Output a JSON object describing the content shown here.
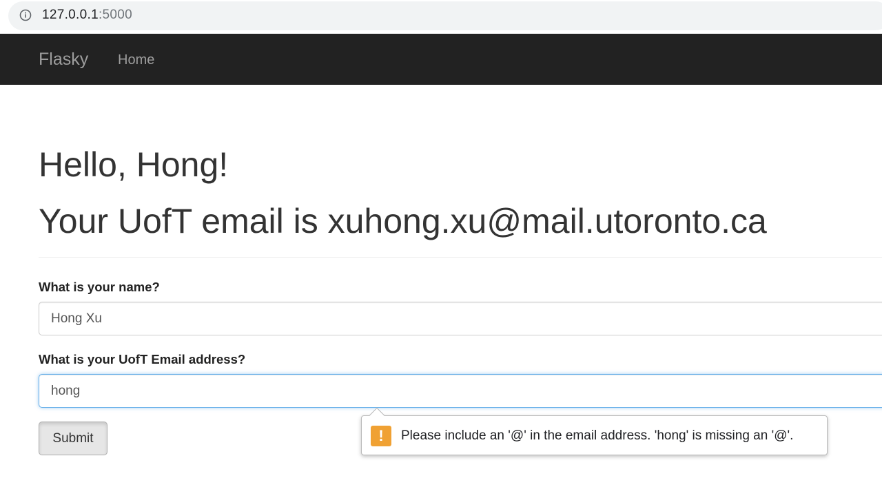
{
  "browser": {
    "url_host": "127.0.0.1",
    "url_port": ":5000"
  },
  "navbar": {
    "brand": "Flasky",
    "items": [
      {
        "label": "Home"
      }
    ]
  },
  "main": {
    "greeting": "Hello, Hong!",
    "email_line": "Your UofT email is xuhong.xu@mail.utoronto.ca"
  },
  "form": {
    "name_label": "What is your name?",
    "name_value": "Hong Xu",
    "email_label": "What is your UofT Email address?",
    "email_value": "hong",
    "submit_label": "Submit"
  },
  "validation": {
    "icon_glyph": "!",
    "message": "Please include an '@' in the email address. 'hong' is missing an '@'.",
    "icon_color": "#f0a133"
  },
  "colors": {
    "navbar_bg": "#222222",
    "nav_text": "#9d9d9d",
    "focus_border": "#66afe9"
  }
}
